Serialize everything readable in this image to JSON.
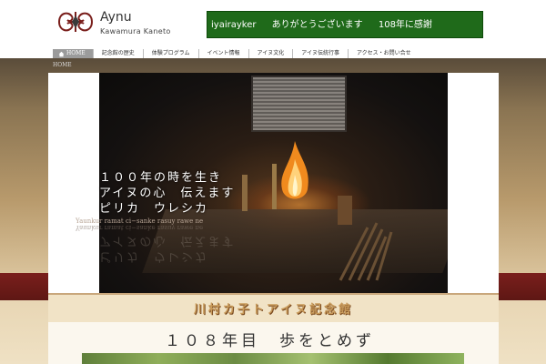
{
  "header": {
    "logo_icon": "ainu-pattern-emblem",
    "title": "Aynu",
    "subtitle": "Kawamura  Kaneto",
    "banner": {
      "parts": [
        "iyairayker",
        "ありがとうございます",
        "108年に感謝"
      ],
      "bg_color": "#1f6a1a"
    }
  },
  "nav": {
    "items": [
      {
        "label": "HOME",
        "icon": "house-icon",
        "active": true
      },
      {
        "label": "記念館の歴史"
      },
      {
        "label": "体験プログラム"
      },
      {
        "label": "イベント情報"
      },
      {
        "label": "アイヌ文化"
      },
      {
        "label": "アイヌ伝統行事"
      },
      {
        "label": "アクセス・お問い合せ"
      }
    ]
  },
  "breadcrumb": "HOME",
  "hero": {
    "lines": [
      "１００年の時を生き",
      "アイヌの心　伝えます",
      "ピリカ　ウレシカ"
    ],
    "sub": "Yaunkur ramat ci−sanke rasuy rawe ne"
  },
  "museum": {
    "title": "川村カ子トアイヌ記念館"
  },
  "year": {
    "title": "１０８年目　歩をとめず"
  },
  "colors": {
    "accent_red": "#7a1f1c",
    "gold": "#c89a5a"
  }
}
